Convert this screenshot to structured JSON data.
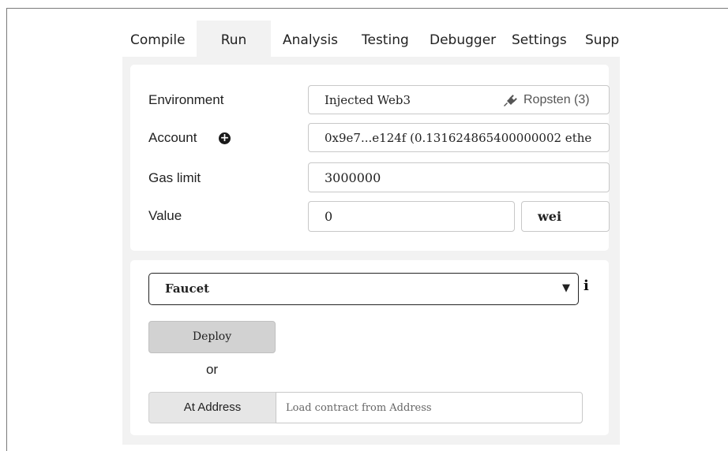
{
  "tabs": [
    {
      "label": "Compile"
    },
    {
      "label": "Run",
      "active": true
    },
    {
      "label": "Analysis"
    },
    {
      "label": "Testing"
    },
    {
      "label": "Debugger"
    },
    {
      "label": "Settings"
    },
    {
      "label": "Supp"
    }
  ],
  "settings": {
    "environment": {
      "label": "Environment",
      "value": "Injected Web3",
      "network": "Ropsten (3)",
      "network_icon": "plug-icon"
    },
    "account": {
      "label": "Account",
      "add_icon": "plus-circle-icon",
      "value": "0x9e7...e124f (0.131624865400000002 ethe"
    },
    "gas_limit": {
      "label": "Gas limit",
      "value": "3000000"
    },
    "value": {
      "label": "Value",
      "amount": "0",
      "unit": "wei"
    }
  },
  "contract": {
    "selected": "Faucet",
    "info_icon": "info-icon",
    "deploy_label": "Deploy",
    "or_label": "or",
    "at_address_label": "At Address",
    "address_placeholder": "Load contract from Address"
  },
  "colors": {
    "panel_bg": "#f2f2f2",
    "card_bg": "#ffffff",
    "deploy_bg": "#d2d2d2",
    "at_address_bg": "#e6e6e6"
  }
}
